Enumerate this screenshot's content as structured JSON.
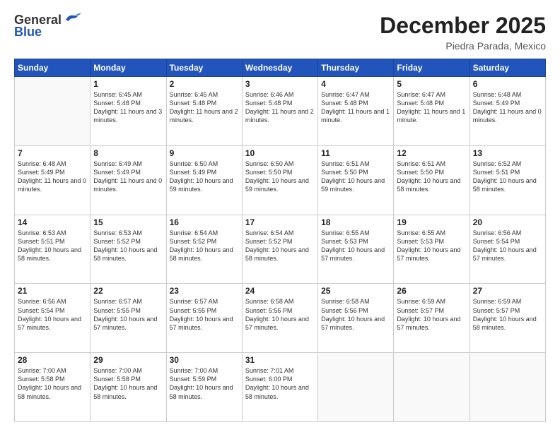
{
  "header": {
    "logo_general": "General",
    "logo_blue": "Blue",
    "month_title": "December 2025",
    "location": "Piedra Parada, Mexico"
  },
  "days_of_week": [
    "Sunday",
    "Monday",
    "Tuesday",
    "Wednesday",
    "Thursday",
    "Friday",
    "Saturday"
  ],
  "weeks": [
    [
      {
        "day": "",
        "sunrise": "",
        "sunset": "",
        "daylight": ""
      },
      {
        "day": "1",
        "sunrise": "Sunrise: 6:45 AM",
        "sunset": "Sunset: 5:48 PM",
        "daylight": "Daylight: 11 hours and 3 minutes."
      },
      {
        "day": "2",
        "sunrise": "Sunrise: 6:45 AM",
        "sunset": "Sunset: 5:48 PM",
        "daylight": "Daylight: 11 hours and 2 minutes."
      },
      {
        "day": "3",
        "sunrise": "Sunrise: 6:46 AM",
        "sunset": "Sunset: 5:48 PM",
        "daylight": "Daylight: 11 hours and 2 minutes."
      },
      {
        "day": "4",
        "sunrise": "Sunrise: 6:47 AM",
        "sunset": "Sunset: 5:48 PM",
        "daylight": "Daylight: 11 hours and 1 minute."
      },
      {
        "day": "5",
        "sunrise": "Sunrise: 6:47 AM",
        "sunset": "Sunset: 5:48 PM",
        "daylight": "Daylight: 11 hours and 1 minute."
      },
      {
        "day": "6",
        "sunrise": "Sunrise: 6:48 AM",
        "sunset": "Sunset: 5:49 PM",
        "daylight": "Daylight: 11 hours and 0 minutes."
      }
    ],
    [
      {
        "day": "7",
        "sunrise": "Sunrise: 6:48 AM",
        "sunset": "Sunset: 5:49 PM",
        "daylight": "Daylight: 11 hours and 0 minutes."
      },
      {
        "day": "8",
        "sunrise": "Sunrise: 6:49 AM",
        "sunset": "Sunset: 5:49 PM",
        "daylight": "Daylight: 11 hours and 0 minutes."
      },
      {
        "day": "9",
        "sunrise": "Sunrise: 6:50 AM",
        "sunset": "Sunset: 5:49 PM",
        "daylight": "Daylight: 10 hours and 59 minutes."
      },
      {
        "day": "10",
        "sunrise": "Sunrise: 6:50 AM",
        "sunset": "Sunset: 5:50 PM",
        "daylight": "Daylight: 10 hours and 59 minutes."
      },
      {
        "day": "11",
        "sunrise": "Sunrise: 6:51 AM",
        "sunset": "Sunset: 5:50 PM",
        "daylight": "Daylight: 10 hours and 59 minutes."
      },
      {
        "day": "12",
        "sunrise": "Sunrise: 6:51 AM",
        "sunset": "Sunset: 5:50 PM",
        "daylight": "Daylight: 10 hours and 58 minutes."
      },
      {
        "day": "13",
        "sunrise": "Sunrise: 6:52 AM",
        "sunset": "Sunset: 5:51 PM",
        "daylight": "Daylight: 10 hours and 58 minutes."
      }
    ],
    [
      {
        "day": "14",
        "sunrise": "Sunrise: 6:53 AM",
        "sunset": "Sunset: 5:51 PM",
        "daylight": "Daylight: 10 hours and 58 minutes."
      },
      {
        "day": "15",
        "sunrise": "Sunrise: 6:53 AM",
        "sunset": "Sunset: 5:52 PM",
        "daylight": "Daylight: 10 hours and 58 minutes."
      },
      {
        "day": "16",
        "sunrise": "Sunrise: 6:54 AM",
        "sunset": "Sunset: 5:52 PM",
        "daylight": "Daylight: 10 hours and 58 minutes."
      },
      {
        "day": "17",
        "sunrise": "Sunrise: 6:54 AM",
        "sunset": "Sunset: 5:52 PM",
        "daylight": "Daylight: 10 hours and 58 minutes."
      },
      {
        "day": "18",
        "sunrise": "Sunrise: 6:55 AM",
        "sunset": "Sunset: 5:53 PM",
        "daylight": "Daylight: 10 hours and 57 minutes."
      },
      {
        "day": "19",
        "sunrise": "Sunrise: 6:55 AM",
        "sunset": "Sunset: 5:53 PM",
        "daylight": "Daylight: 10 hours and 57 minutes."
      },
      {
        "day": "20",
        "sunrise": "Sunrise: 6:56 AM",
        "sunset": "Sunset: 5:54 PM",
        "daylight": "Daylight: 10 hours and 57 minutes."
      }
    ],
    [
      {
        "day": "21",
        "sunrise": "Sunrise: 6:56 AM",
        "sunset": "Sunset: 5:54 PM",
        "daylight": "Daylight: 10 hours and 57 minutes."
      },
      {
        "day": "22",
        "sunrise": "Sunrise: 6:57 AM",
        "sunset": "Sunset: 5:55 PM",
        "daylight": "Daylight: 10 hours and 57 minutes."
      },
      {
        "day": "23",
        "sunrise": "Sunrise: 6:57 AM",
        "sunset": "Sunset: 5:55 PM",
        "daylight": "Daylight: 10 hours and 57 minutes."
      },
      {
        "day": "24",
        "sunrise": "Sunrise: 6:58 AM",
        "sunset": "Sunset: 5:56 PM",
        "daylight": "Daylight: 10 hours and 57 minutes."
      },
      {
        "day": "25",
        "sunrise": "Sunrise: 6:58 AM",
        "sunset": "Sunset: 5:56 PM",
        "daylight": "Daylight: 10 hours and 57 minutes."
      },
      {
        "day": "26",
        "sunrise": "Sunrise: 6:59 AM",
        "sunset": "Sunset: 5:57 PM",
        "daylight": "Daylight: 10 hours and 57 minutes."
      },
      {
        "day": "27",
        "sunrise": "Sunrise: 6:59 AM",
        "sunset": "Sunset: 5:57 PM",
        "daylight": "Daylight: 10 hours and 58 minutes."
      }
    ],
    [
      {
        "day": "28",
        "sunrise": "Sunrise: 7:00 AM",
        "sunset": "Sunset: 5:58 PM",
        "daylight": "Daylight: 10 hours and 58 minutes."
      },
      {
        "day": "29",
        "sunrise": "Sunrise: 7:00 AM",
        "sunset": "Sunset: 5:58 PM",
        "daylight": "Daylight: 10 hours and 58 minutes."
      },
      {
        "day": "30",
        "sunrise": "Sunrise: 7:00 AM",
        "sunset": "Sunset: 5:59 PM",
        "daylight": "Daylight: 10 hours and 58 minutes."
      },
      {
        "day": "31",
        "sunrise": "Sunrise: 7:01 AM",
        "sunset": "Sunset: 6:00 PM",
        "daylight": "Daylight: 10 hours and 58 minutes."
      },
      {
        "day": "",
        "sunrise": "",
        "sunset": "",
        "daylight": ""
      },
      {
        "day": "",
        "sunrise": "",
        "sunset": "",
        "daylight": ""
      },
      {
        "day": "",
        "sunrise": "",
        "sunset": "",
        "daylight": ""
      }
    ]
  ]
}
